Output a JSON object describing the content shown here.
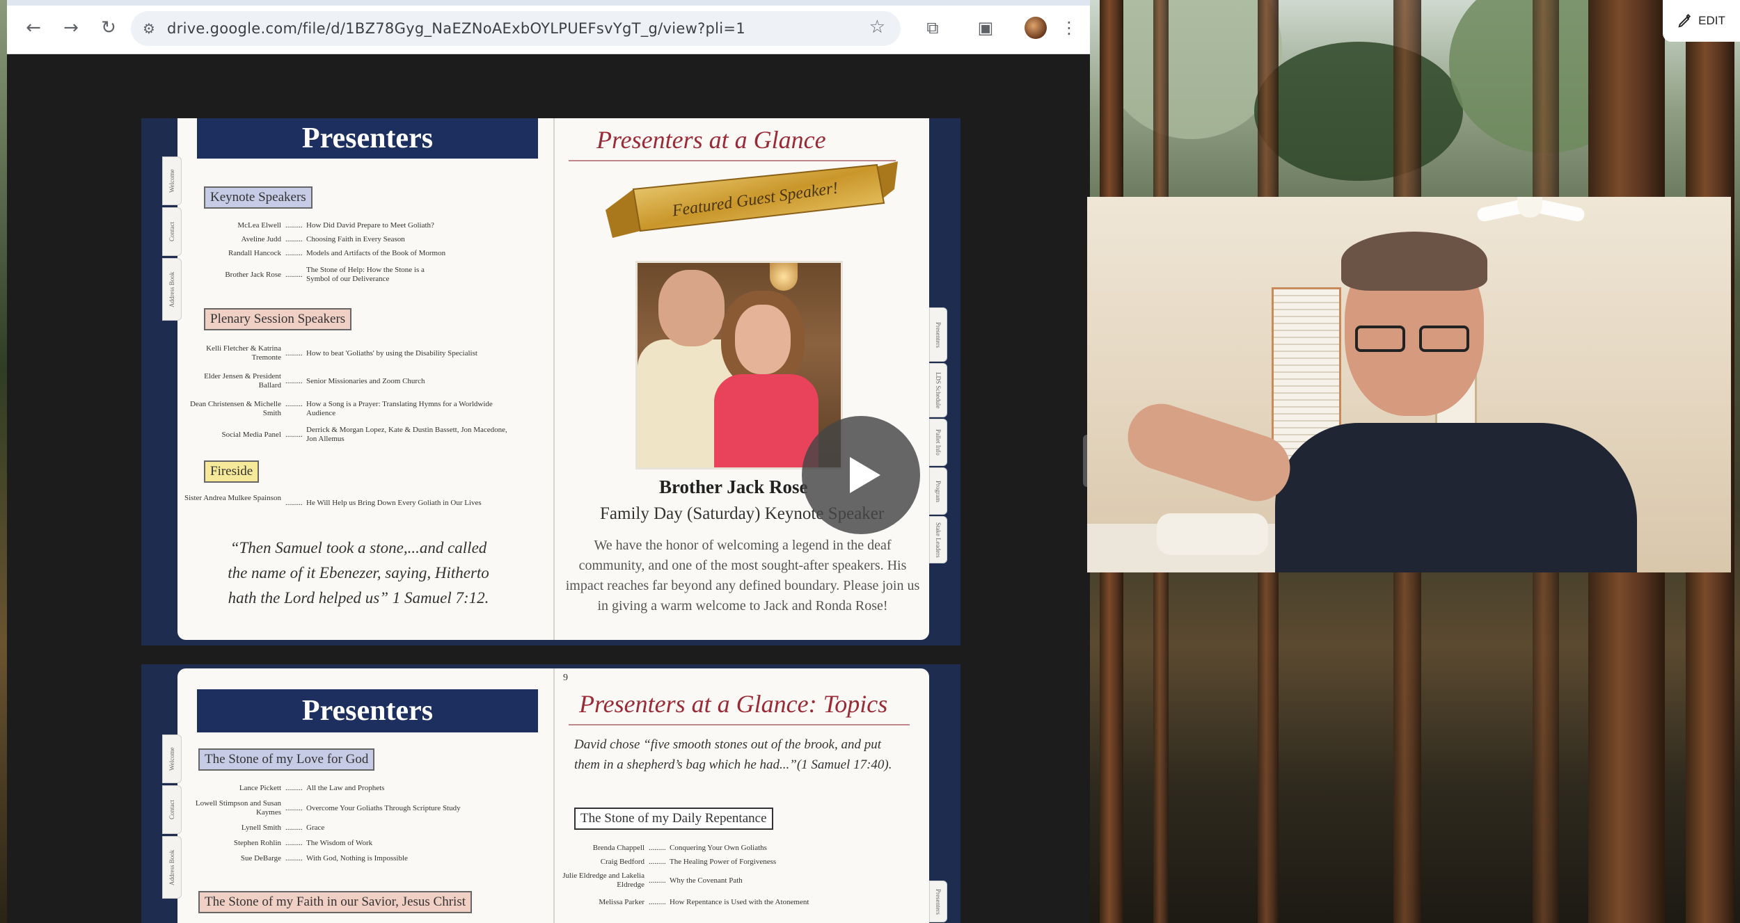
{
  "browser": {
    "url": "drive.google.com/file/d/1BZ78Gyg_NaEZNoAExbOYLPUEFsvYgT_g/view?pli=1"
  },
  "overlay": {
    "edit_label": "EDIT"
  },
  "doc": {
    "page1_left": {
      "title": "Presenters",
      "tabs": [
        "Welcome",
        "Contact",
        "Address Book"
      ],
      "sections": [
        {
          "label": "Keynote Speakers",
          "rows": [
            {
              "name": "McLea Elwell",
              "topic": "How Did David Prepare to Meet Goliath?"
            },
            {
              "name": "Aveline Judd",
              "topic": "Choosing Faith in Every Season"
            },
            {
              "name": "Randall Hancock",
              "topic": "Models and Artifacts of the Book of Mormon"
            },
            {
              "name": "Brother Jack Rose",
              "topic": "The Stone of Help: How the Stone is a Symbol of our Deliverance"
            }
          ]
        },
        {
          "label": "Plenary Session Speakers",
          "rows": [
            {
              "name": "Kelli Fletcher & Katrina Tremonte",
              "topic": "How to beat 'Goliaths' by using the Disability Specialist"
            },
            {
              "name": "Elder Jensen & President Ballard",
              "topic": "Senior Missionaries and Zoom Church"
            },
            {
              "name": "Dean Christensen & Michelle Smith",
              "topic": "How a Song is a Prayer: Translating Hymns for a Worldwide Audience"
            },
            {
              "name": "Social Media Panel",
              "topic": "Derrick & Morgan Lopez, Kate & Dustin Bassett, Jon Macedone, Jon Allemus"
            }
          ]
        },
        {
          "label": "Fireside",
          "rows": [
            {
              "name": "Sister Andrea Mulkee Spainson",
              "topic": "He Will Help us Bring Down Every Goliath in Our Lives"
            }
          ]
        }
      ],
      "quote": "“Then Samuel took a stone,...and called the name of it Ebenezer, saying, Hitherto hath the Lord helped us” 1 Samuel 7:12."
    },
    "page1_right": {
      "title": "Presenters at a Glance",
      "banner": "Featured Guest Speaker!",
      "name": "Brother Jack Rose",
      "subtitle": "Family Day (Saturday) Keynote Speaker",
      "paragraph": "We have the honor of welcoming a legend in the deaf community, and one of the most sought-after speakers. His impact reaches far beyond any defined boundary. Please join us in giving a warm welcome to Jack and Ronda Rose!",
      "tabs": [
        "Presenters",
        "LDS Schedule",
        "Pallet Info",
        "Program",
        "Stake Leaders"
      ]
    },
    "page2_left": {
      "title": "Presenters",
      "sections": [
        {
          "label": "The Stone of my Love for God",
          "rows": [
            {
              "name": "Lance Pickett",
              "topic": "All the Law and Prophets"
            },
            {
              "name": "Lowell Stimpson and Susan Kaymes",
              "topic": "Overcome Your Goliaths Through Scripture Study"
            },
            {
              "name": "Lynell Smith",
              "topic": "Grace"
            },
            {
              "name": "Stephen Rohlin",
              "topic": "The Wisdom of Work"
            },
            {
              "name": "Sue DeBarge",
              "topic": "With God, Nothing is Impossible"
            }
          ]
        },
        {
          "label": "The Stone of my Faith in our Savior, Jesus Christ",
          "rows": []
        }
      ]
    },
    "page2_right": {
      "page_number": "9",
      "title": "Presenters at a Glance: Topics",
      "intro": "David chose “five smooth stones out of the brook, and put them in a shepherd’s bag which he had...”(1 Samuel 17:40).",
      "sections": [
        {
          "label": "The Stone of my Daily Repentance",
          "rows": [
            {
              "name": "Brenda Chappell",
              "topic": "Conquering Your Own Goliaths"
            },
            {
              "name": "Craig Bedford",
              "topic": "The Healing Power of Forgiveness"
            },
            {
              "name": "Julie Eldredge and Lakelia Eldredge",
              "topic": "Why the Covenant Path"
            },
            {
              "name": "Melissa Parker",
              "topic": "How Repentance is Used with the Atonement"
            }
          ]
        }
      ]
    }
  }
}
